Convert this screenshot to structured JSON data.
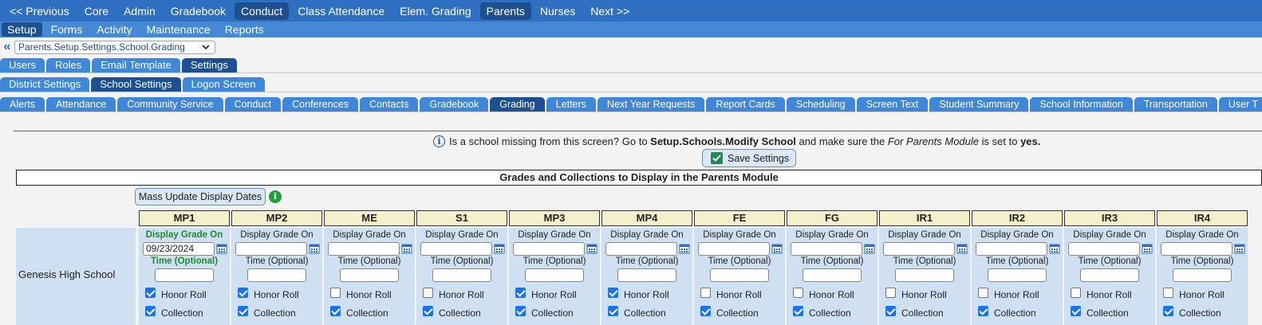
{
  "nav_top": [
    {
      "label": "<< Previous",
      "selected": false
    },
    {
      "label": "Core",
      "selected": false
    },
    {
      "label": "Admin",
      "selected": false
    },
    {
      "label": "Gradebook",
      "selected": false
    },
    {
      "label": "Conduct",
      "selected": true
    },
    {
      "label": "Class Attendance",
      "selected": false
    },
    {
      "label": "Elem. Grading",
      "selected": false
    },
    {
      "label": "Parents",
      "selected": true
    },
    {
      "label": "Nurses",
      "selected": false
    },
    {
      "label": "Next >>",
      "selected": false
    }
  ],
  "nav_sub": [
    {
      "label": "Setup",
      "selected": true
    },
    {
      "label": "Forms",
      "selected": false
    },
    {
      "label": "Activity",
      "selected": false
    },
    {
      "label": "Maintenance",
      "selected": false
    },
    {
      "label": "Reports",
      "selected": false
    }
  ],
  "breadcrumb": {
    "back": "«",
    "value": "Parents.Setup.Settings.School.Grading"
  },
  "tabs_level1": [
    {
      "label": "Users",
      "selected": false
    },
    {
      "label": "Roles",
      "selected": false
    },
    {
      "label": "Email Template",
      "selected": false
    },
    {
      "label": "Settings",
      "selected": true
    }
  ],
  "tabs_level2": [
    {
      "label": "District Settings",
      "selected": false
    },
    {
      "label": "School Settings",
      "selected": true
    },
    {
      "label": "Logon Screen",
      "selected": false
    }
  ],
  "tabs_level3": [
    {
      "label": "Alerts",
      "selected": false
    },
    {
      "label": "Attendance",
      "selected": false
    },
    {
      "label": "Community Service",
      "selected": false
    },
    {
      "label": "Conduct",
      "selected": false
    },
    {
      "label": "Conferences",
      "selected": false
    },
    {
      "label": "Contacts",
      "selected": false
    },
    {
      "label": "Gradebook",
      "selected": false
    },
    {
      "label": "Grading",
      "selected": true
    },
    {
      "label": "Letters",
      "selected": false
    },
    {
      "label": "Next Year Requests",
      "selected": false
    },
    {
      "label": "Report Cards",
      "selected": false
    },
    {
      "label": "Scheduling",
      "selected": false
    },
    {
      "label": "Screen Text",
      "selected": false
    },
    {
      "label": "Student Summary",
      "selected": false
    },
    {
      "label": "School Information",
      "selected": false
    },
    {
      "label": "Transportation",
      "selected": false
    },
    {
      "label": "User T",
      "selected": false
    }
  ],
  "info": {
    "icon": "info-icon",
    "prefix": "Is a school missing from this screen? Go to ",
    "link": "Setup.Schools.Modify School",
    "middle": " and make sure the ",
    "field": "For Parents Module",
    "suffix_text": " is set to ",
    "value": "yes."
  },
  "save_button": "Save Settings",
  "section_title": "Grades and Collections to Display in the Parents Module",
  "mass_update_button": "Mass Update Display Dates",
  "school_name": "Genesis High School",
  "display_label": "Display Grade On",
  "time_label": "Time (Optional)",
  "honor_label": "Honor Roll",
  "collection_label": "Collection",
  "colors": {
    "nav": "#2f6fc2",
    "subnav": "#4588d6",
    "selected": "#1d4f91",
    "header_cell": "#f4f0cc",
    "row_bg": "#cfe0f2",
    "green": "#1f8a2e"
  },
  "periods": [
    {
      "name": "MP1",
      "date": "09/23/2024",
      "active": true,
      "honor_roll": true,
      "collection": true
    },
    {
      "name": "MP2",
      "date": "",
      "active": false,
      "honor_roll": true,
      "collection": true
    },
    {
      "name": "ME",
      "date": "",
      "active": false,
      "honor_roll": false,
      "collection": true
    },
    {
      "name": "S1",
      "date": "",
      "active": false,
      "honor_roll": false,
      "collection": true
    },
    {
      "name": "MP3",
      "date": "",
      "active": false,
      "honor_roll": true,
      "collection": true
    },
    {
      "name": "MP4",
      "date": "",
      "active": false,
      "honor_roll": true,
      "collection": true
    },
    {
      "name": "FE",
      "date": "",
      "active": false,
      "honor_roll": false,
      "collection": true
    },
    {
      "name": "FG",
      "date": "",
      "active": false,
      "honor_roll": false,
      "collection": true
    },
    {
      "name": "IR1",
      "date": "",
      "active": false,
      "honor_roll": false,
      "collection": true
    },
    {
      "name": "IR2",
      "date": "",
      "active": false,
      "honor_roll": false,
      "collection": true
    },
    {
      "name": "IR3",
      "date": "",
      "active": false,
      "honor_roll": false,
      "collection": true
    },
    {
      "name": "IR4",
      "date": "",
      "active": false,
      "honor_roll": false,
      "collection": true
    }
  ]
}
